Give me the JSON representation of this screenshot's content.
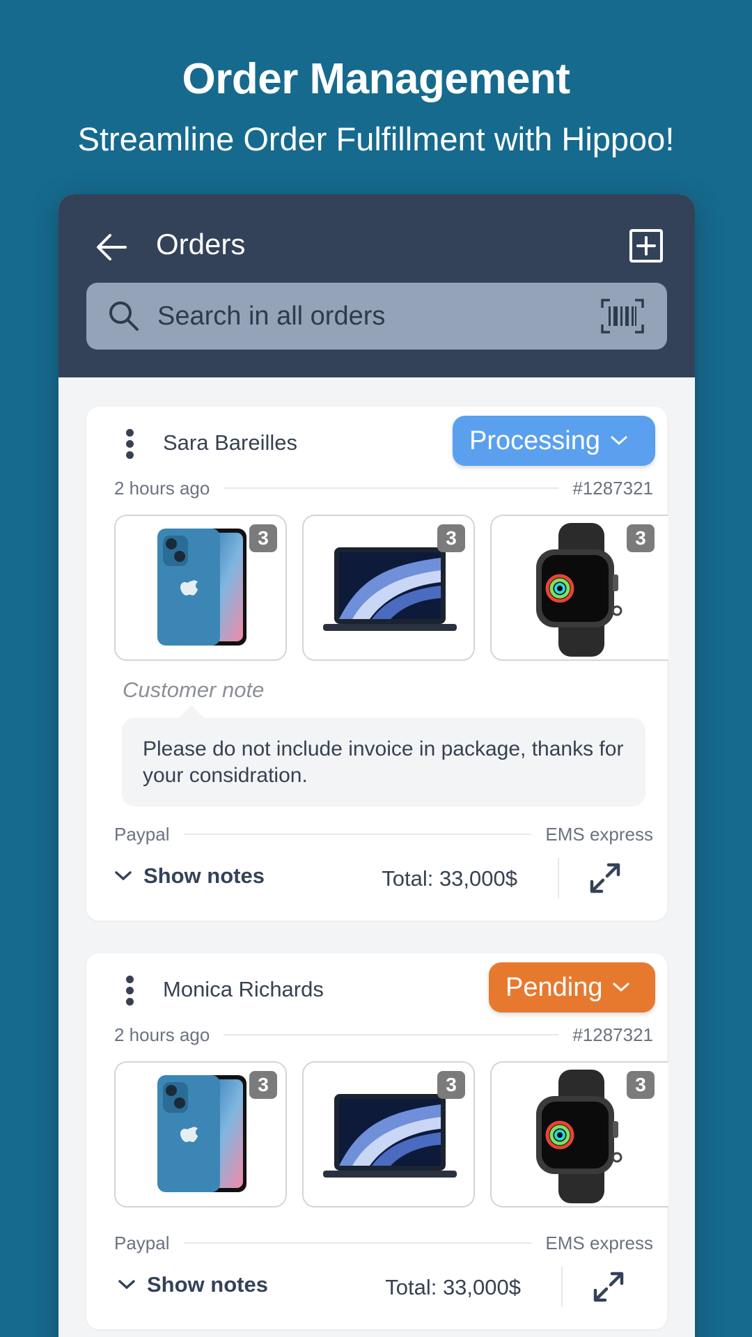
{
  "hero": {
    "title": "Order Management",
    "subtitle": "Streamline Order Fulfillment with Hippoo!"
  },
  "appbar": {
    "back_icon": "arrow-left-icon",
    "title": "Orders",
    "add_icon": "add-square-icon",
    "search_placeholder": "Search in all orders",
    "search_icon": "search-icon",
    "barcode_icon": "barcode-scan-icon"
  },
  "colors": {
    "background": "#166a8e",
    "appbar": "#334259",
    "processing": "#5aa0ee",
    "pending": "#e7792f"
  },
  "orders": [
    {
      "customer": "Sara Bareilles",
      "status": "Processing",
      "time": "2 hours ago",
      "order_id": "#1287321",
      "products": [
        {
          "name": "iPhone",
          "icon": "phone-image",
          "qty": "3"
        },
        {
          "name": "MacBook",
          "icon": "laptop-image",
          "qty": "3"
        },
        {
          "name": "Apple Watch",
          "icon": "watch-image",
          "qty": "3"
        }
      ],
      "note_label": "Customer note",
      "note": "Please do not include invoice in package, thanks for your considration.",
      "payment": "Paypal",
      "shipping": "EMS express",
      "show_notes": "Show notes",
      "total": "Total: 33,000$"
    },
    {
      "customer": "Monica Richards",
      "status": "Pending",
      "time": "2 hours ago",
      "order_id": "#1287321",
      "products": [
        {
          "name": "iPhone",
          "icon": "phone-image",
          "qty": "3"
        },
        {
          "name": "MacBook",
          "icon": "laptop-image",
          "qty": "3"
        },
        {
          "name": "Apple Watch",
          "icon": "watch-image",
          "qty": "3"
        }
      ],
      "payment": "Paypal",
      "shipping": "EMS express",
      "show_notes": "Show notes",
      "total": "Total: 33,000$"
    }
  ]
}
